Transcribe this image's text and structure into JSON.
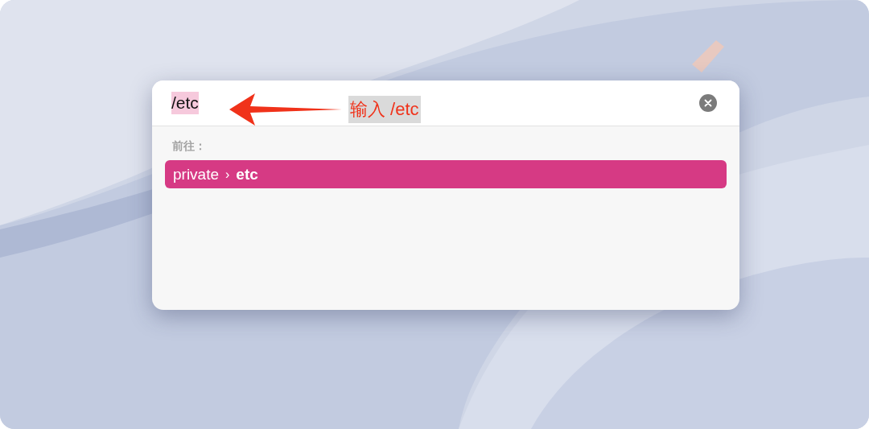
{
  "search": {
    "value": "/etc",
    "selected": true
  },
  "annotation": {
    "text": "输入 /etc"
  },
  "results": {
    "heading": "前往：",
    "items": [
      {
        "path": "private",
        "separator": "›",
        "target": "etc",
        "selected": true
      }
    ]
  }
}
